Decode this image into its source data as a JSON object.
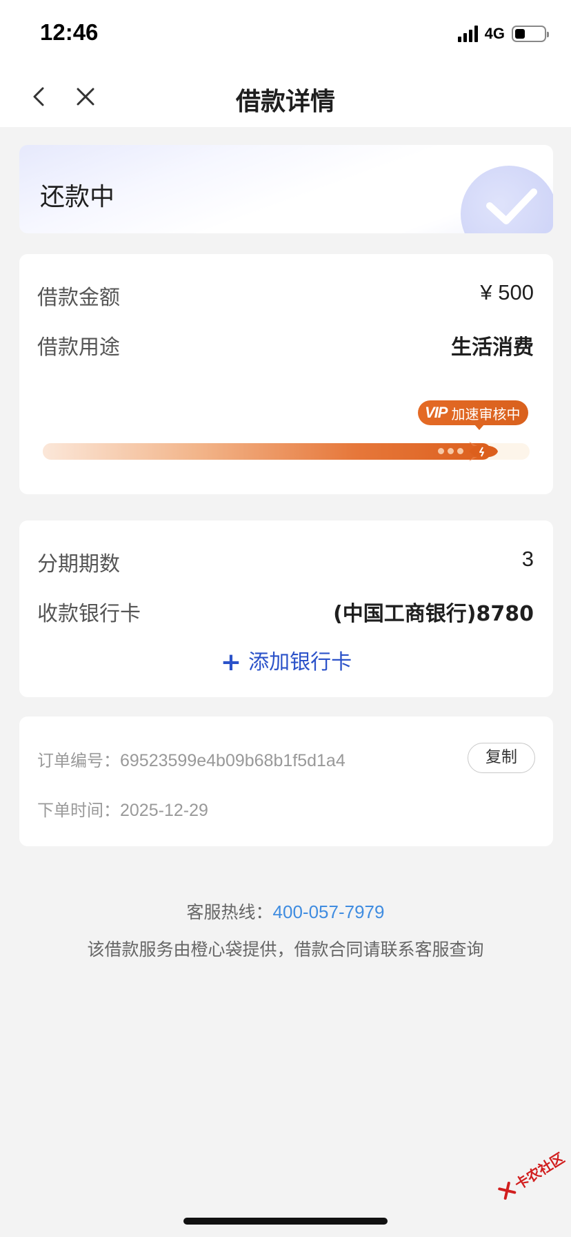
{
  "status_bar": {
    "time": "12:46",
    "network": "4G",
    "battery_level": 0.35
  },
  "nav": {
    "title": "借款详情",
    "back_icon": "chevron-left-icon",
    "close_icon": "close-icon"
  },
  "status_card": {
    "status": "还款中",
    "icon": "check-icon"
  },
  "loan": {
    "amount_label": "借款金额",
    "amount_value": "¥ 500",
    "purpose_label": "借款用途",
    "purpose_value": "生活消费",
    "vip_mark": "VIP",
    "vip_text": "加速审核中",
    "progress": 0.92,
    "accent_color": "#dc5f1d"
  },
  "bank": {
    "installments_label": "分期期数",
    "installments_value": "3",
    "card_label": "收款银行卡",
    "card_value": "(中国工商银行)8780",
    "add_card_label": "添加银行卡",
    "add_icon": "plus-icon",
    "link_color": "#2b52c9"
  },
  "order": {
    "number_label": "订单编号：",
    "number_value": "69523599e4b09b68b1f5d1a4",
    "copy_label": "复制",
    "time_label": "下单时间：",
    "time_value": "2025-12-29"
  },
  "footer": {
    "hotline_label": "客服热线：",
    "hotline_number": "400-057-7979",
    "notice": "该借款服务由橙心袋提供，借款合同请联系客服查询"
  },
  "watermark": {
    "text": "卡农社区"
  }
}
